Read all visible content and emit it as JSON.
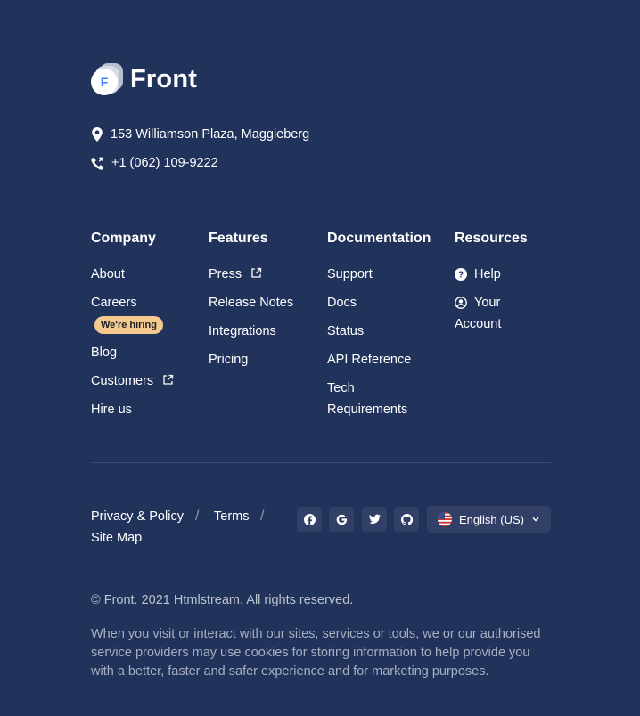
{
  "brand": {
    "name": "Front",
    "logo_letter": "F"
  },
  "contact": {
    "address": "153 Williamson Plaza, Maggieberg",
    "phone": "+1 (062) 109-9222",
    "icons": [
      "map-pin-icon",
      "phone-icon"
    ]
  },
  "columns": {
    "company": {
      "title": "Company",
      "about": "About",
      "careers": "Careers",
      "hiring_badge": "We're hiring",
      "blog": "Blog",
      "customers": "Customers",
      "hire_us": "Hire us"
    },
    "features": {
      "title": "Features",
      "press": "Press",
      "release_notes": "Release Notes",
      "integrations": "Integrations",
      "pricing": "Pricing"
    },
    "documentation": {
      "title": "Documentation",
      "support": "Support",
      "docs": "Docs",
      "status": "Status",
      "api_reference": "API Reference",
      "tech_1": "Tech",
      "tech_2": "Requirements"
    },
    "resources": {
      "title": "Resources",
      "help": "Help",
      "account_1": "Your",
      "account_2": "Account"
    }
  },
  "bottom": {
    "privacy": "Privacy & Policy",
    "separator": "/",
    "terms": "Terms",
    "sitemap": "Site Map",
    "social": [
      "facebook-icon",
      "google-icon",
      "twitter-icon",
      "github-icon"
    ],
    "language": "English (US)"
  },
  "copyright": "© Front. 2021 Htmlstream. All rights reserved.",
  "notice": "When you visit or interact with our sites, services or tools, we or our authorised service providers may use cookies for storing information to help provide you with a better, faster and safer experience and for marketing purposes.",
  "colors": {
    "background": "#21325b",
    "badge": "#f4c98e",
    "brand_blue": "#377dff",
    "button_bg": "#323f67"
  }
}
